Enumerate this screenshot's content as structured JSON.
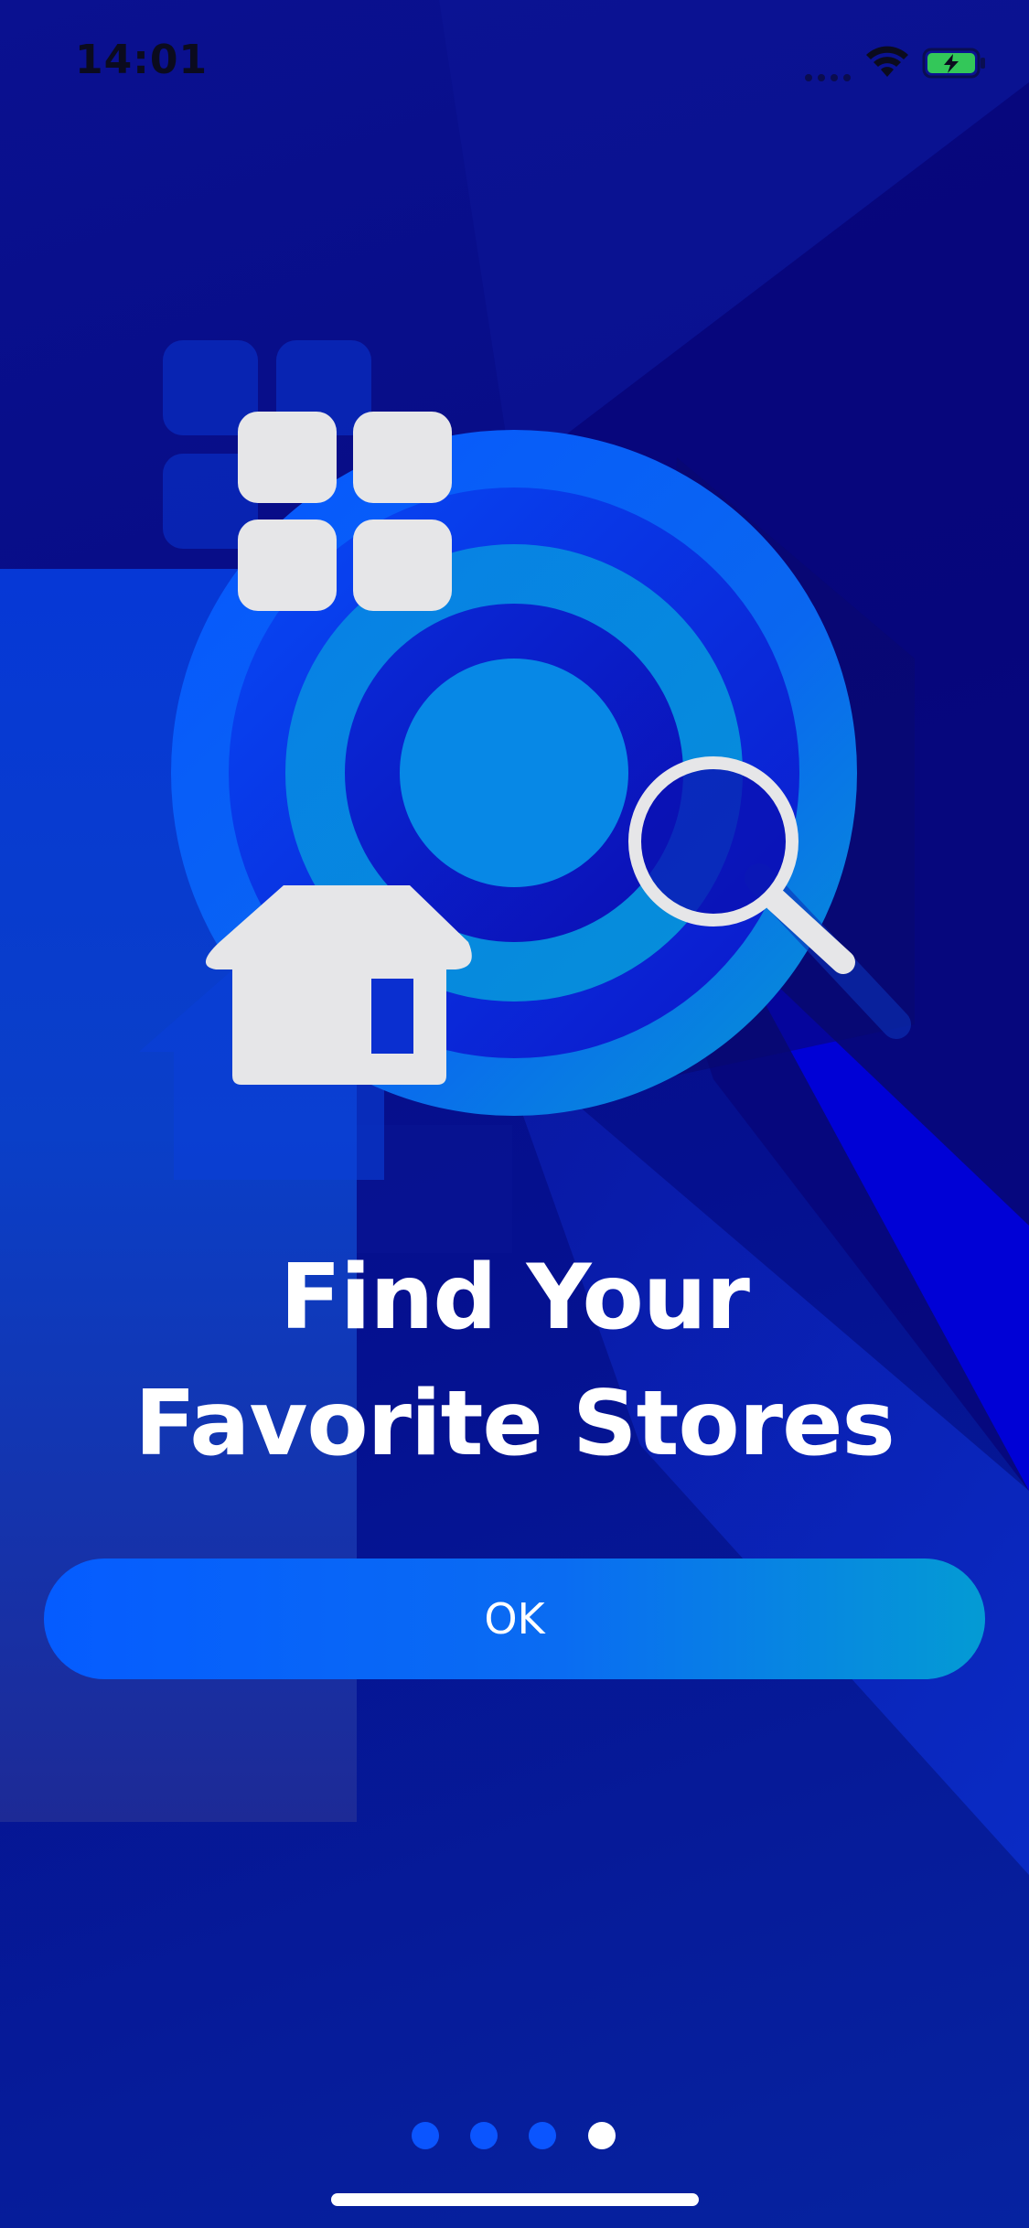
{
  "status_bar": {
    "time": "14:01"
  },
  "onboarding": {
    "title_line1": "Find Your",
    "title_line2": "Favorite Stores",
    "ok_label": "OK",
    "page_count": 4,
    "current_page": 4
  },
  "icons": {
    "wifi": "wifi-icon",
    "battery": "battery-charging-icon",
    "grid": "grid-apps-icon",
    "house": "house-icon",
    "magnifier": "magnifying-glass-icon",
    "target": "target-rings-icon"
  },
  "colors": {
    "background": "#070c86",
    "accent": "#055cff",
    "accent_end": "#049bd4",
    "text": "#ffffff",
    "icon_light": "#e6e6e8",
    "battery_green": "#33c759"
  }
}
